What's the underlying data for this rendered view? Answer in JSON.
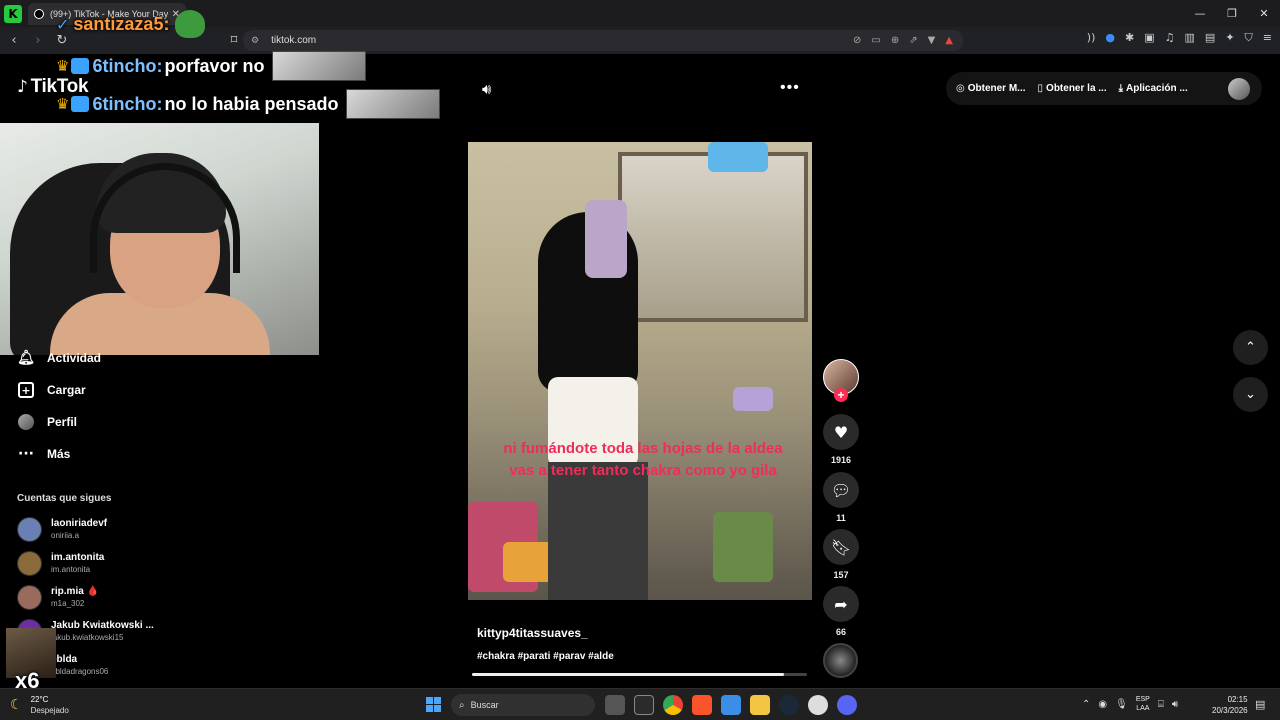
{
  "browser": {
    "tab_title": "(99+) TikTok - Make Your Day",
    "url": "tiktok.com",
    "window_controls": [
      "—",
      "❐",
      "✕"
    ]
  },
  "tiktok": {
    "logo_text": "TikTok",
    "sidebar": [
      {
        "label": "Actividad",
        "icon": "bell-icon"
      },
      {
        "label": "Cargar",
        "icon": "upload-icon"
      },
      {
        "label": "Perfil",
        "icon": "profile-avatar-icon"
      },
      {
        "label": "Más",
        "icon": "more-dots-icon"
      }
    ],
    "following_title": "Cuentas que sigues",
    "following": [
      {
        "name": "laoniriadevf",
        "handle": "oniriia.a",
        "color": "#6a7fb3"
      },
      {
        "name": "im.antonita",
        "handle": "im.antonita",
        "color": "#8b6a3a"
      },
      {
        "name": "rip.mia 🩸",
        "handle": "m1a_302",
        "color": "#9a6b5c"
      },
      {
        "name": "Jakub Kwiatkowski ...",
        "handle": "jakub.kwiatkowski15",
        "color": "#6d2da5"
      },
      {
        "name": "eblda",
        "handle": "ebldadragons06",
        "color": "#444444"
      }
    ],
    "top_actions": [
      "Obtener M...",
      "Obtener la ...",
      "Aplicación ..."
    ],
    "video": {
      "caption_overlay": "ni fumándote toda las hojas de la aldea vas a tener tanto chakra como yo gila",
      "author": "kittyp4titassuaves_",
      "tags": "#chakra #parati #parav #alde",
      "progress": 0.93
    },
    "rail": {
      "likes": "1916",
      "comments": "11",
      "saves": "157",
      "shares": "66"
    }
  },
  "stream_overlay": {
    "top_user": "santizaza5:",
    "chat": [
      {
        "user": "6tincho:",
        "message": "porfavor no"
      },
      {
        "user": "6tincho:",
        "message": "no lo habia pensado"
      }
    ],
    "multiplier": "x6"
  },
  "taskbar": {
    "temp": "22°C",
    "condition": "Despejado",
    "search_placeholder": "Buscar",
    "lang_line1": "ESP",
    "lang_line2": "LAA",
    "time": "02:15",
    "date": "20/3/2026"
  }
}
